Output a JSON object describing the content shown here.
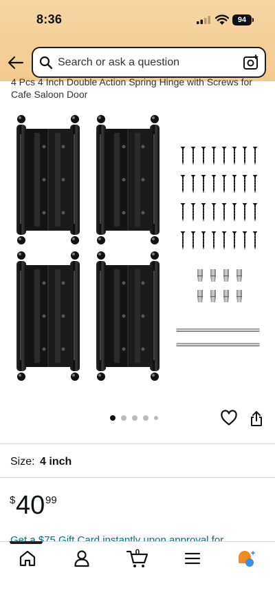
{
  "status_bar": {
    "time": "8:36",
    "battery": "94"
  },
  "search": {
    "placeholder": "Search or ask a question"
  },
  "product": {
    "title": "4 Pcs 4 Inch Double Action Spring Hinge with Screws for Cafe Saloon Door",
    "image_alt": "Four black double action spring hinges with screws, pins and rods",
    "gallery_count": 5,
    "gallery_active": 1
  },
  "size": {
    "label": "Size:",
    "value": "4 inch"
  },
  "price": {
    "symbol": "$",
    "whole": "40",
    "fraction": "99"
  },
  "promo": {
    "text": "Get a $75 Gift Card instantly upon approval for"
  },
  "bottom_nav": {
    "cart_count": "0"
  },
  "colors": {
    "header": "#f3c98d",
    "link": "#007185",
    "text": "#0f1111"
  },
  "icons": [
    "back-arrow-icon",
    "search-icon",
    "camera-icon",
    "heart-icon",
    "share-icon",
    "home-icon",
    "account-icon",
    "cart-icon",
    "menu-icon",
    "rufus-icon"
  ]
}
